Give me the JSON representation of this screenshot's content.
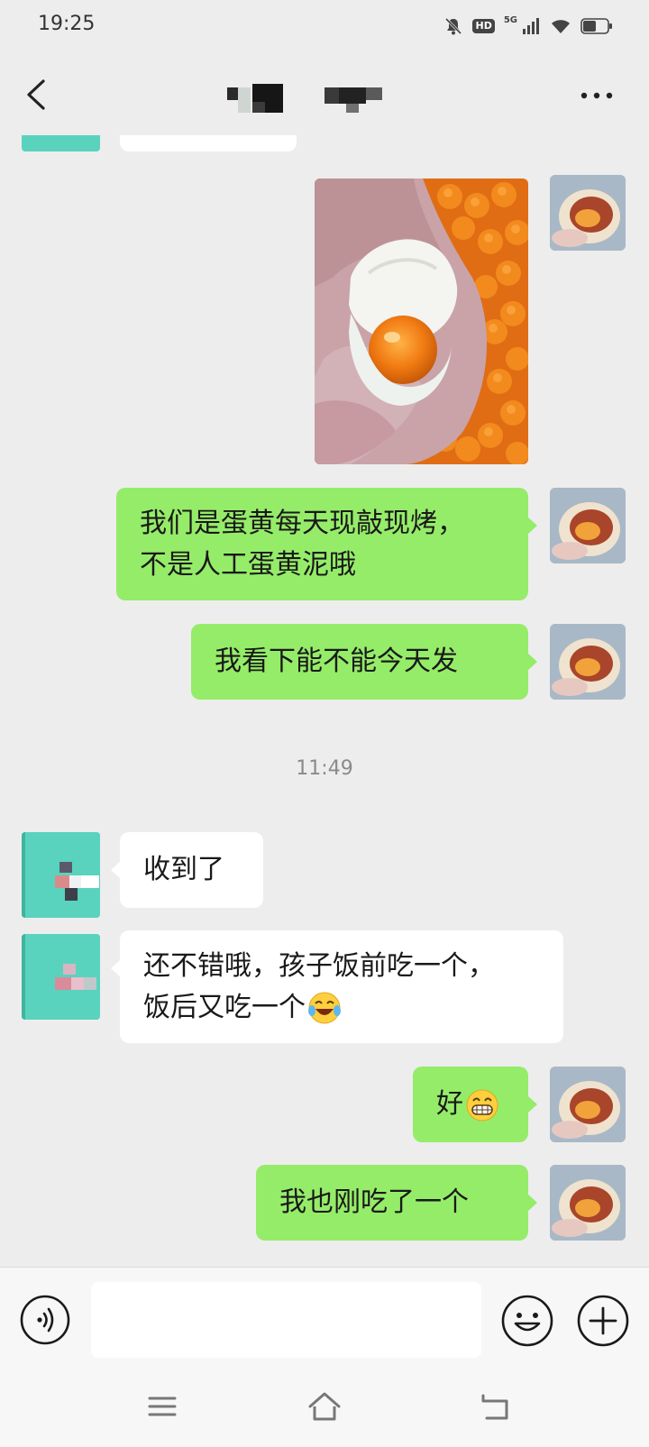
{
  "status_bar": {
    "time": "19:25",
    "hd_label": "HD",
    "network_label": "5G",
    "icons": [
      "bell-muted-icon",
      "hd-icon",
      "signal-5g-icon",
      "wifi-icon",
      "battery-icon"
    ]
  },
  "nav": {
    "back_icon": "chevron-left-icon",
    "title": "",
    "more_icon": "more-dots-icon"
  },
  "messages": [
    {
      "sender": "other",
      "type": "text",
      "text": ""
    },
    {
      "sender": "me",
      "type": "image",
      "description": ""
    },
    {
      "sender": "me",
      "type": "text",
      "text": "我们是蛋黄每天现敲现烤，\n不是人工蛋黄泥哦"
    },
    {
      "sender": "me",
      "type": "text",
      "text": "我看下能不能今天发"
    },
    {
      "type": "timestamp",
      "text": "11:49"
    },
    {
      "sender": "other",
      "type": "text",
      "text": "收到了"
    },
    {
      "sender": "other",
      "type": "text",
      "text": "还不错哦，孩子饭前吃一个，\n饭后又吃一个",
      "emoji": "laugh-cry-emoji"
    },
    {
      "sender": "me",
      "type": "text",
      "text": "好",
      "emoji": "grin-emoji"
    },
    {
      "sender": "me",
      "type": "text",
      "text": "我也刚吃了一个"
    }
  ],
  "input_bar": {
    "placeholder": "",
    "voice_icon": "voice-icon",
    "emoji_icon": "smiley-icon",
    "plus_icon": "plus-icon"
  },
  "system_nav": {
    "icons": [
      "menu-icon",
      "home-icon",
      "back-icon"
    ]
  },
  "colors": {
    "background": "#ededed",
    "bubble_mine": "#95ec69",
    "bubble_other": "#ffffff",
    "avatar_other": "#59d3bd"
  }
}
